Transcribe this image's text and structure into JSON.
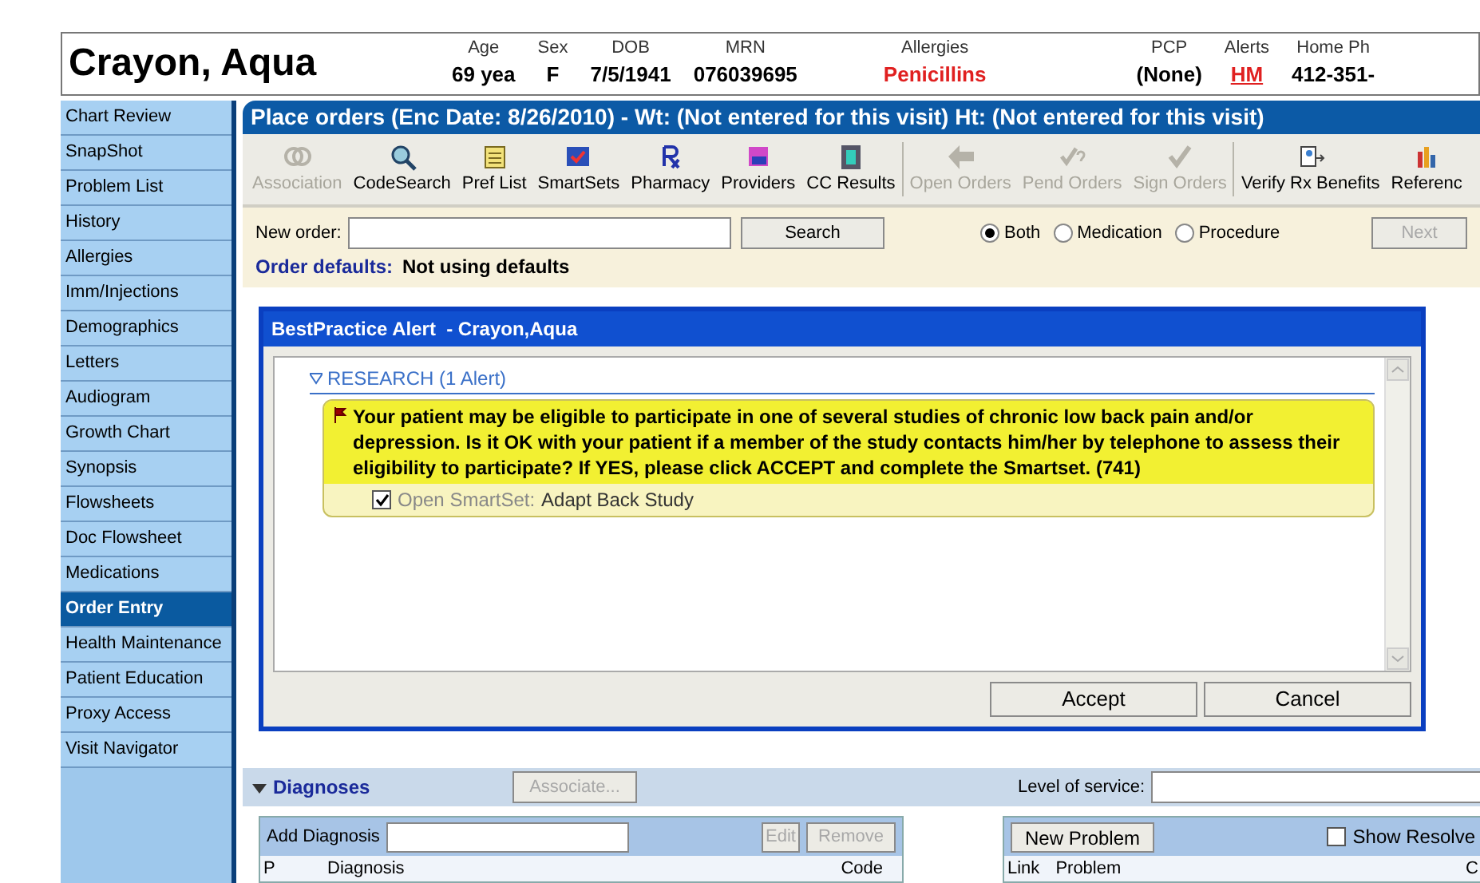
{
  "patient": {
    "name": "Crayon, Aqua",
    "fields": [
      {
        "label": "Age",
        "value": "69 yea",
        "kind": "plain"
      },
      {
        "label": "Sex",
        "value": "F",
        "kind": "plain"
      },
      {
        "label": "DOB",
        "value": "7/5/1941",
        "kind": "plain"
      },
      {
        "label": "MRN",
        "value": "076039695",
        "kind": "plain"
      },
      {
        "label": "Allergies",
        "value": "Penicillins",
        "kind": "alert"
      },
      {
        "label": "PCP",
        "value": "(None)",
        "kind": "plain"
      },
      {
        "label": "Alerts",
        "value": "HM",
        "kind": "alert-link"
      },
      {
        "label": "Home Ph",
        "value": "412-351-",
        "kind": "plain"
      }
    ]
  },
  "sidebar": {
    "items": [
      {
        "label": "Chart Review",
        "selected": false
      },
      {
        "label": "SnapShot",
        "selected": false
      },
      {
        "label": "Problem List",
        "selected": false
      },
      {
        "label": "History",
        "selected": false
      },
      {
        "label": "Allergies",
        "selected": false
      },
      {
        "label": "Imm/Injections",
        "selected": false
      },
      {
        "label": "Demographics",
        "selected": false
      },
      {
        "label": "Letters",
        "selected": false
      },
      {
        "label": "Audiogram",
        "selected": false
      },
      {
        "label": "Growth Chart",
        "selected": false
      },
      {
        "label": "Synopsis",
        "selected": false
      },
      {
        "label": "Flowsheets",
        "selected": false
      },
      {
        "label": "Doc Flowsheet",
        "selected": false
      },
      {
        "label": "Medications",
        "selected": false
      },
      {
        "label": "Order Entry",
        "selected": true
      },
      {
        "label": "Health Maintenance",
        "selected": false
      },
      {
        "label": "Patient Education",
        "selected": false
      },
      {
        "label": "Proxy Access",
        "selected": false
      },
      {
        "label": "Visit Navigator",
        "selected": false
      }
    ]
  },
  "main": {
    "title": "Place orders (Enc Date: 8/26/2010) - Wt: (Not entered for this visit) Ht: (Not entered for this visit)",
    "toolbar": [
      [
        {
          "label": "Association",
          "disabled": true
        },
        {
          "label": "CodeSearch",
          "disabled": false
        },
        {
          "label": "Pref List",
          "disabled": false
        },
        {
          "label": "SmartSets",
          "disabled": false
        },
        {
          "label": "Pharmacy",
          "disabled": false
        },
        {
          "label": "Providers",
          "disabled": false
        },
        {
          "label": "CC Results",
          "disabled": false
        }
      ],
      [
        {
          "label": "Open Orders",
          "disabled": true
        },
        {
          "label": "Pend Orders",
          "disabled": true
        },
        {
          "label": "Sign Orders",
          "disabled": true
        }
      ],
      [
        {
          "label": "Verify Rx Benefits",
          "disabled": false
        },
        {
          "label": "Referenc",
          "disabled": false
        }
      ]
    ],
    "new_order": {
      "label": "New order:",
      "search_button": "Search",
      "next_button": {
        "label": "Next",
        "disabled": true
      }
    },
    "order_types": [
      {
        "label": "Both",
        "selected": true
      },
      {
        "label": "Medication",
        "selected": false
      },
      {
        "label": "Procedure",
        "selected": false
      }
    ],
    "order_defaults": {
      "label": "Order defaults:",
      "value": "Not using defaults"
    }
  },
  "dialog": {
    "title": "BestPractice Alert  - Crayon,Aqua",
    "section": "RESEARCH (1 Alert)",
    "section_expanded": true,
    "alert": "Your patient may be eligible to participate in one of several studies of chronic low back pain and/or depression. Is it OK with your patient if a member of the study contacts him/her by telephone to assess their eligibility to participate? If YES, please click ACCEPT and complete the Smartset. (741)",
    "action": {
      "label": "Open SmartSet:",
      "value": "Adapt Back Study",
      "checked": true
    },
    "buttons": [
      "Accept",
      "Cancel"
    ]
  },
  "diagnoses": {
    "title": "Diagnoses",
    "expanded": true,
    "associate_button": {
      "label": "Associate...",
      "disabled": true
    },
    "level_of_service_label": "Level of service:",
    "add_label": "Add Diagnosis",
    "edit_button": {
      "label": "Edit",
      "disabled": true
    },
    "remove_button": {
      "label": "Remove",
      "disabled": true
    },
    "columns": [
      "P",
      "Diagnosis",
      "Code"
    ],
    "new_problem_button": "New Problem",
    "show_resolved": {
      "label": "Show Resolve",
      "checked": false
    },
    "problem_columns": [
      "Link",
      "Problem",
      "C"
    ]
  }
}
